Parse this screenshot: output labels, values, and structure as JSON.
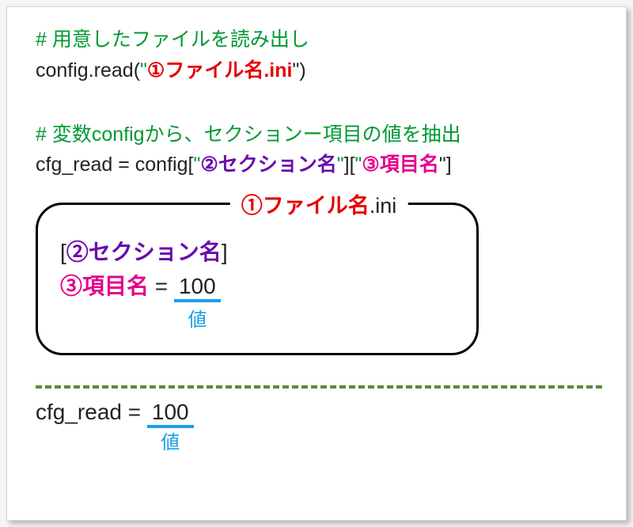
{
  "comments": {
    "c1": "# 用意したファイルを読み出し",
    "c2_prefix": "# 変数",
    "c2_var": "config",
    "c2_suffix": "から、セクションー項目の値を抽出"
  },
  "code": {
    "read_prefix": "config.read(",
    "read_q1": "\"",
    "read_file_num": "①",
    "read_file_label": "ファイル名",
    "read_file_ext": ".ini",
    "read_q2": "\"",
    "read_suffix": ")",
    "cfg_prefix": "cfg_read = config[",
    "cfg_q1": "\"",
    "cfg_sec_num": "②",
    "cfg_sec_label": "セクション名",
    "cfg_q2": "\"",
    "cfg_mid": "][",
    "cfg_q3": "\"",
    "cfg_item_num": "③",
    "cfg_item_label": "項目名",
    "cfg_q4": "\"",
    "cfg_suffix": "]"
  },
  "filebox": {
    "title_num": "①",
    "title_label": "ファイル名",
    "title_ext": ".ini",
    "section_l": "[",
    "section_num": "②",
    "section_label": "セクション名",
    "section_r": "]",
    "item_num": "③",
    "item_label": "項目名",
    "item_eq": " = ",
    "item_value": "100",
    "item_caption": "値"
  },
  "result": {
    "prefix": "cfg_read = ",
    "value": "100",
    "caption": "値"
  }
}
